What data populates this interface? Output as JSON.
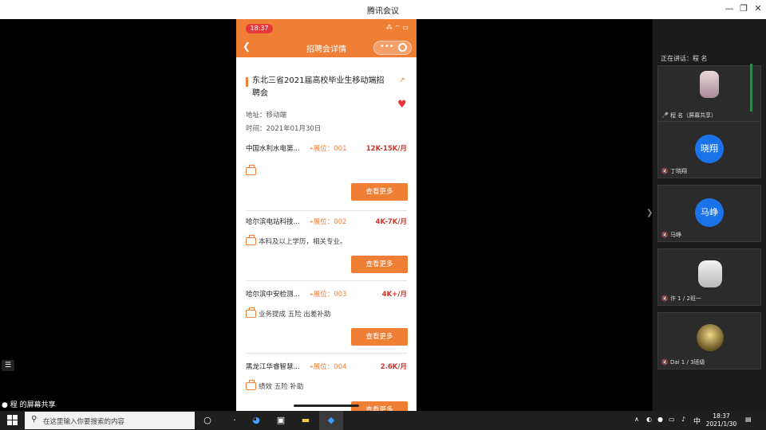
{
  "window": {
    "title": "腾讯会议",
    "minimize": "—",
    "restore": "❐",
    "close": "✕"
  },
  "phone": {
    "status_time": "18:37",
    "status_icons": "⁂ ⌔ ▭",
    "header_title": "招聘会详情",
    "capsule_dots": "•••",
    "fair": {
      "title": "东北三省2021届高校毕业生移动端招聘会",
      "address": "地址：移动端",
      "time": "时间：2021年01月30日"
    },
    "jobs": [
      {
        "name": "中国水利水电第...",
        "booth": "展位：001",
        "salary": "12K-15K/月",
        "requirement": "",
        "button": "查看更多"
      },
      {
        "name": "哈尔滨电站科技...",
        "booth": "展位：002",
        "salary": "4K-7K/月",
        "requirement": "本科及以上学历，相关专业。",
        "button": "查看更多"
      },
      {
        "name": "哈尔滨中安检测...",
        "booth": "展位：003",
        "salary": "4K+/月",
        "requirement": "业务提成 五险 出差补助",
        "button": "查看更多"
      },
      {
        "name": "黑龙江华睿智慧...",
        "booth": "展位：004",
        "salary": "2.6K/月",
        "requirement": "绩效 五险 补助",
        "button": "查看更多"
      }
    ]
  },
  "panel": {
    "header": "正在讲话：程   名",
    "participants": [
      {
        "label": "程   名（屏幕共享）",
        "initials": ""
      },
      {
        "label": "丁晓翔",
        "initials": "晓翔"
      },
      {
        "label": "马峥",
        "initials": "马峥"
      },
      {
        "label": "许   1 / 2班一",
        "initials": ""
      },
      {
        "label": "Dai   1 / 3班级",
        "initials": ""
      }
    ]
  },
  "share_label": "程   的屏幕共享",
  "taskbar": {
    "search_placeholder": "在这里输入你要搜索的内容",
    "ime": "中",
    "time": "18:37",
    "date": "2021/1/30"
  }
}
